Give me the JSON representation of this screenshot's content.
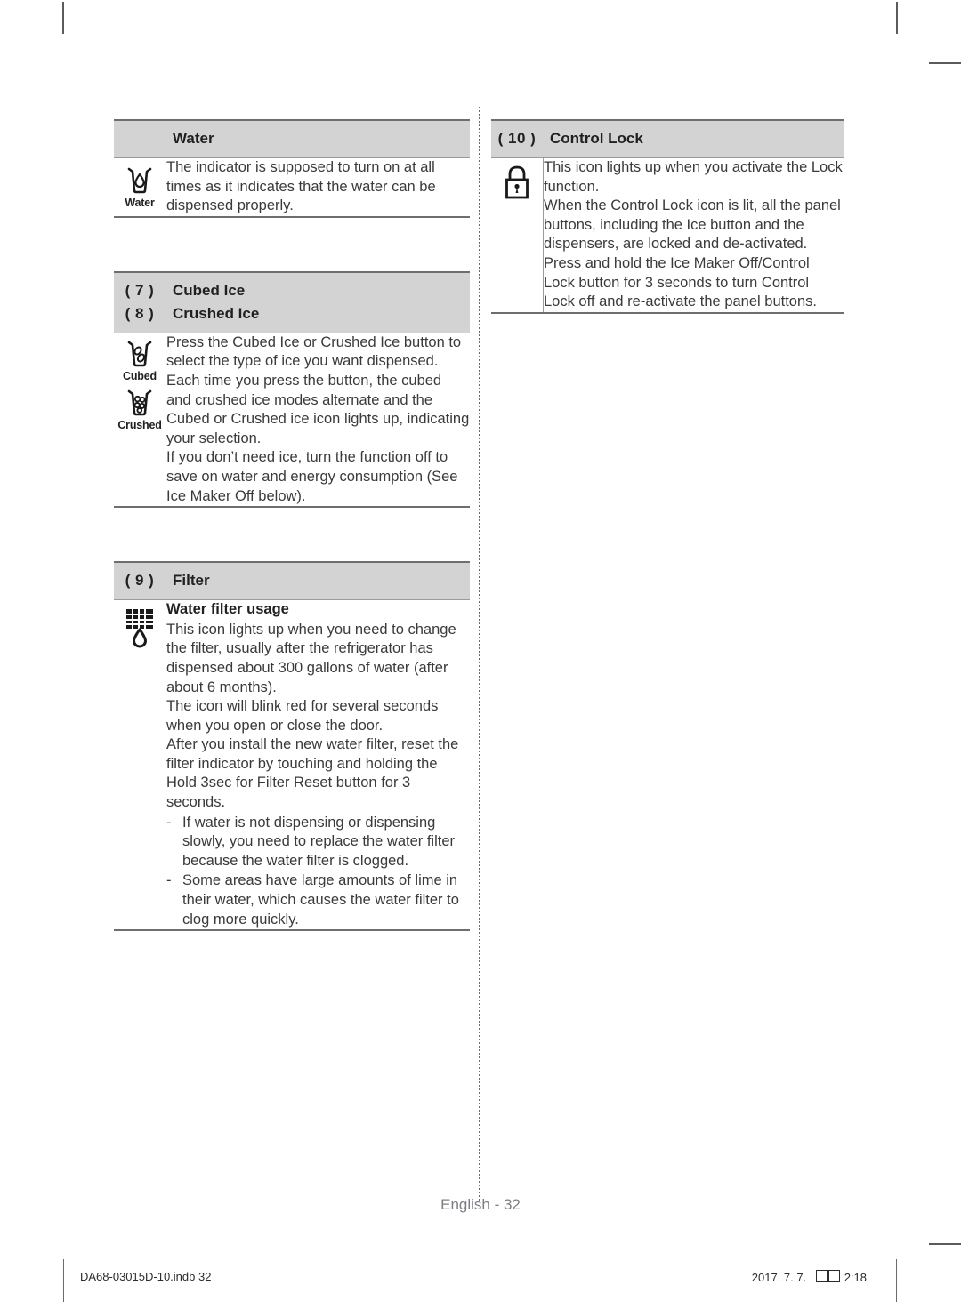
{
  "document": {
    "page_label": "English - 32",
    "footer_file": "DA68-03015D-10.indb   32",
    "footer_page_number": "32",
    "footer_date": "2017. 7. 7.",
    "footer_time": "2:18"
  },
  "left_column": {
    "sections": [
      {
        "number": "",
        "title": "Water",
        "icons": [
          {
            "name": "water-glass-icon",
            "caption": "Water"
          }
        ],
        "paragraphs": [
          "The indicator is supposed to turn on at all times as it indicates that the water can be dispensed properly."
        ]
      },
      {
        "number_lines": [
          {
            "number": "( 7 )",
            "title": "Cubed Ice"
          },
          {
            "number": "( 8 )",
            "title": "Crushed Ice"
          }
        ],
        "icons": [
          {
            "name": "cubed-ice-icon",
            "caption": "Cubed"
          },
          {
            "name": "crushed-ice-icon",
            "caption": "Crushed"
          }
        ],
        "paragraphs": [
          "Press the Cubed Ice or Crushed Ice button to select the type of ice you want dispensed.",
          "Each time you press the button, the cubed and crushed ice modes alternate and the Cubed or Crushed ice icon lights up, indicating your selection.",
          "If you don’t need ice, turn the function off to save on water and energy consumption (See Ice Maker Off below)."
        ]
      },
      {
        "number": "( 9 )",
        "title": "Filter",
        "icons": [
          {
            "name": "water-filter-icon",
            "caption": ""
          }
        ],
        "sub_heading": "Water filter usage",
        "paragraphs": [
          "This icon lights up when you need to change the filter, usually after the refrigerator has dispensed about 300 gallons of water (after about 6 months).",
          "The icon will blink red for several seconds when you open or close the door.",
          "After you install the new water filter, reset the filter indicator by touching and holding the Hold 3sec for Filter Reset button for 3 seconds."
        ],
        "bullets": [
          {
            "mark": "-",
            "text": "If water is not dispensing or dispensing slowly, you need to replace the water filter because the water filter is clogged."
          },
          {
            "mark": "-",
            "text": "Some areas have large amounts of lime in their water, which causes the water filter to clog more quickly."
          }
        ]
      }
    ]
  },
  "right_column": {
    "sections": [
      {
        "number": "( 10 )",
        "title": "Control Lock",
        "icons": [
          {
            "name": "padlock-icon",
            "caption": ""
          }
        ],
        "paragraphs": [
          "This icon lights up when you activate the Lock function.",
          "When the Control Lock icon is lit, all the panel buttons, including the Ice button and the dispensers, are locked and de-activated.",
          "Press and hold the Ice Maker Off/Control Lock button for 3 seconds to turn Control Lock off and re-activate the panel buttons."
        ]
      }
    ]
  }
}
